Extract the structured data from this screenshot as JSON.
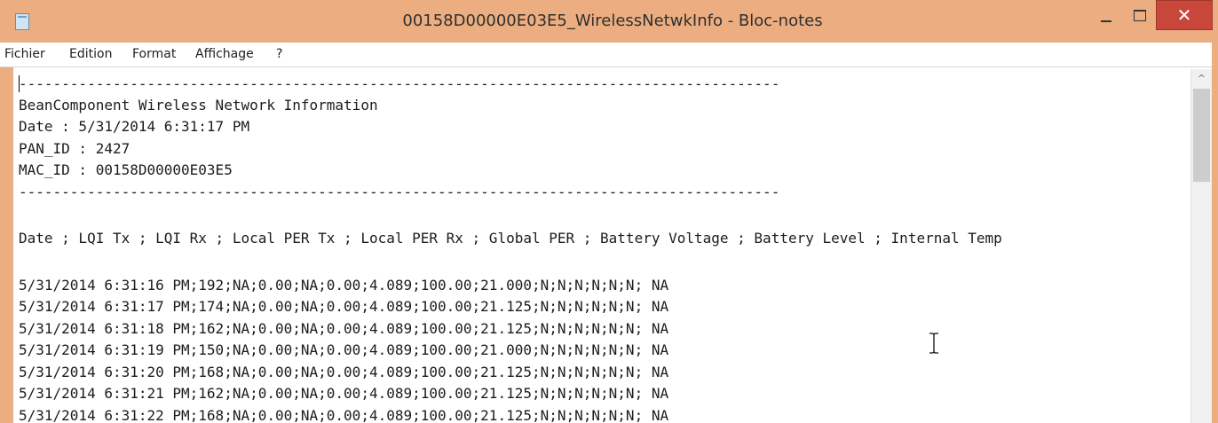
{
  "window": {
    "title": "00158D00000E03E5_WirelessNetwkInfo - Bloc-notes",
    "close_glyph": "✕",
    "app_icon": "notepad-icon",
    "colors": {
      "frame": "#ecae80",
      "close": "#c9463b"
    }
  },
  "menu": {
    "items": [
      "Fichier",
      "Edition",
      "Format",
      "Affichage",
      "?"
    ]
  },
  "document": {
    "lines": [
      "-----------------------------------------------------------------------------------------",
      "BeanComponent Wireless Network Information",
      "Date : 5/31/2014 6:31:17 PM",
      "PAN_ID : 2427",
      "MAC_ID : 00158D00000E03E5",
      "-----------------------------------------------------------------------------------------",
      "",
      "Date ; LQI Tx ; LQI Rx ; Local PER Tx ; Local PER Rx ; Global PER ; Battery Voltage ; Battery Level ; Internal Temp",
      "",
      "5/31/2014 6:31:16 PM;192;NA;0.00;NA;0.00;4.089;100.00;21.000;N;N;N;N;N;N; NA",
      "5/31/2014 6:31:17 PM;174;NA;0.00;NA;0.00;4.089;100.00;21.125;N;N;N;N;N;N; NA",
      "5/31/2014 6:31:18 PM;162;NA;0.00;NA;0.00;4.089;100.00;21.125;N;N;N;N;N;N; NA",
      "5/31/2014 6:31:19 PM;150;NA;0.00;NA;0.00;4.089;100.00;21.000;N;N;N;N;N;N; NA",
      "5/31/2014 6:31:20 PM;168;NA;0.00;NA;0.00;4.089;100.00;21.125;N;N;N;N;N;N; NA",
      "5/31/2014 6:31:21 PM;162;NA;0.00;NA;0.00;4.089;100.00;21.125;N;N;N;N;N;N; NA",
      "5/31/2014 6:31:22 PM;168;NA;0.00;NA;0.00;4.089;100.00;21.125;N;N;N;N;N;N; NA"
    ]
  },
  "scrollbar": {
    "up_glyph": "^"
  }
}
